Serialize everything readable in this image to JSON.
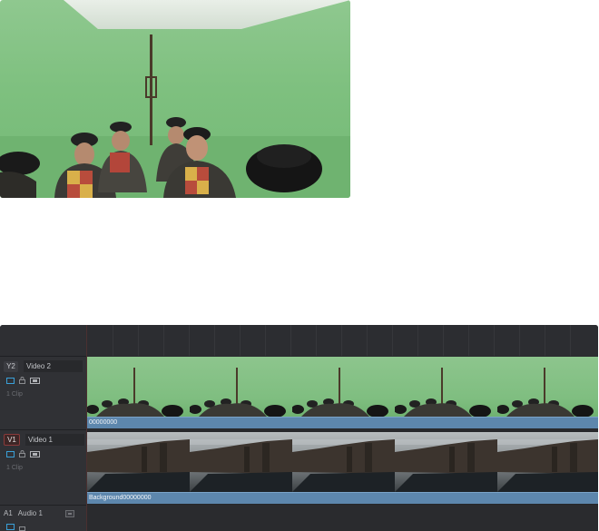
{
  "tracks": {
    "video2": {
      "id": "Y2",
      "name": "Video 2",
      "clip_count": "1 Clip",
      "clip_label": "00000000"
    },
    "video1": {
      "id": "V1",
      "name": "Video 1",
      "clip_count": "1 Clip",
      "clip_label": "Background00000000"
    },
    "audio1": {
      "id": "A1",
      "name": "Audio 1"
    }
  },
  "colors": {
    "clip_bar": "#5d87ad",
    "track_bg": "#26272a",
    "header_bg": "#303135",
    "active_track_border": "#8a3a3a"
  },
  "icons": [
    "monitor-icon",
    "lock-icon",
    "auto-select-icon",
    "record-arm-icon"
  ]
}
